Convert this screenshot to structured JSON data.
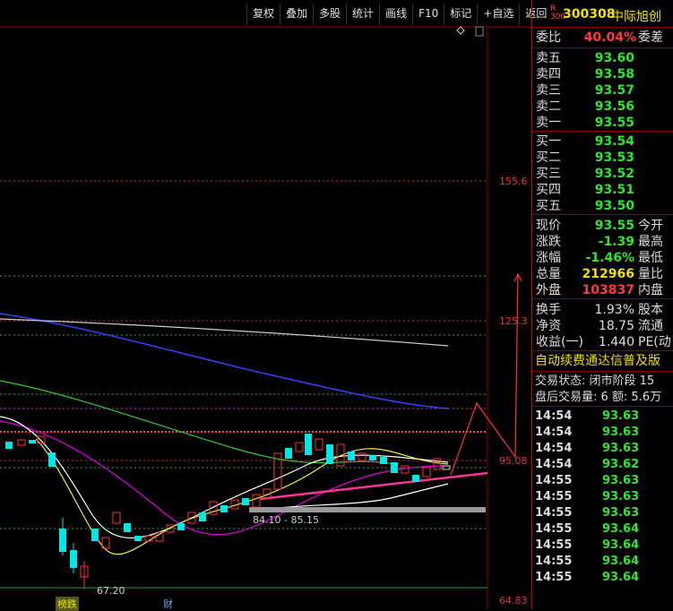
{
  "toolbar": {
    "buttons": [
      "复权",
      "叠加",
      "多股",
      "统计",
      "画线",
      "F10",
      "标记",
      "+自选",
      "返回"
    ]
  },
  "chart": {
    "price_labels": [
      "155.6",
      "125.3",
      "95.08",
      "64.83"
    ],
    "annotation_range": "84.10 - 85.15",
    "annotation_low": "67.20",
    "bottom_marks": [
      "榜跌",
      "财"
    ]
  },
  "stock": {
    "badge_top": "R",
    "badge_bottom": "300",
    "code": "300308",
    "name": "中际旭创"
  },
  "order_book": {
    "wei_bi_label": "委比",
    "wei_bi_value": "40.04%",
    "wei_cha_label": "委差",
    "asks": [
      {
        "label": "卖五",
        "price": "93.60"
      },
      {
        "label": "卖四",
        "price": "93.58"
      },
      {
        "label": "卖三",
        "price": "93.57"
      },
      {
        "label": "卖二",
        "price": "93.56"
      },
      {
        "label": "卖一",
        "price": "93.55"
      }
    ],
    "bids": [
      {
        "label": "买一",
        "price": "93.54"
      },
      {
        "label": "买二",
        "price": "93.53"
      },
      {
        "label": "买三",
        "price": "93.52"
      },
      {
        "label": "买四",
        "price": "93.51"
      },
      {
        "label": "买五",
        "price": "93.50"
      }
    ]
  },
  "quote": {
    "rows": [
      {
        "label": "现价",
        "value": "93.55",
        "right": "今开",
        "color": "g"
      },
      {
        "label": "涨跌",
        "value": "-1.39",
        "right": "最高",
        "color": "g"
      },
      {
        "label": "涨幅",
        "value": "-1.46%",
        "right": "最低",
        "color": "g"
      },
      {
        "label": "总量",
        "value": "212966",
        "right": "量比",
        "color": "y"
      },
      {
        "label": "外盘",
        "value": "103837",
        "right": "内盘",
        "color": "r"
      }
    ]
  },
  "fundamentals": {
    "rows": [
      {
        "label": "换手",
        "value": "1.93%",
        "right": "股本"
      },
      {
        "label": "净资",
        "value": "18.75",
        "right": "流通"
      },
      {
        "label": "收益(一)",
        "value": "1.440",
        "right": "PE(动"
      }
    ]
  },
  "news_ticker": "自动续费通达信普及版",
  "trade_status": {
    "line1": "交易状态: 闭市阶段 15",
    "line2": "盘后交易量: 6  额: 5.6万"
  },
  "ticks": [
    {
      "time": "14:54",
      "price": "93.63"
    },
    {
      "time": "14:54",
      "price": "93.63"
    },
    {
      "time": "14:54",
      "price": "93.63"
    },
    {
      "time": "14:54",
      "price": "93.62"
    },
    {
      "time": "14:55",
      "price": "93.63"
    },
    {
      "time": "14:55",
      "price": "93.63"
    },
    {
      "time": "14:55",
      "price": "93.63"
    },
    {
      "time": "14:55",
      "price": "93.64"
    },
    {
      "time": "14:55",
      "price": "93.64"
    },
    {
      "time": "14:55",
      "price": "93.64"
    },
    {
      "time": "14:55",
      "price": "93.64"
    }
  ]
}
